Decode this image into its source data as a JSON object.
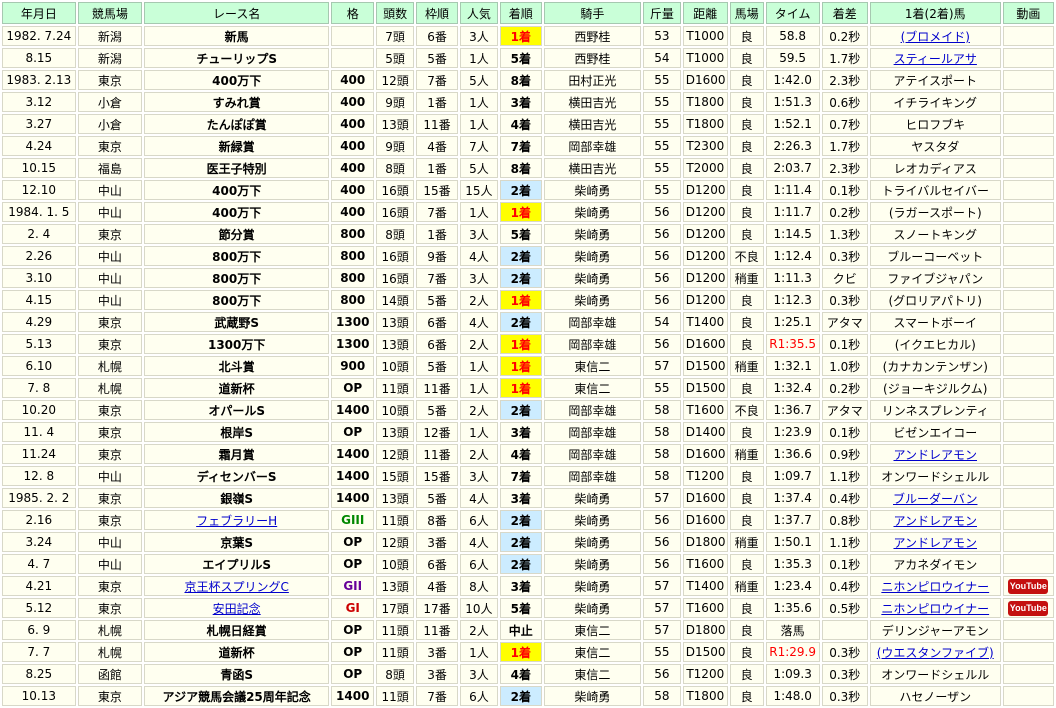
{
  "headers": [
    "年月日",
    "競馬場",
    "レース名",
    "格",
    "頭数",
    "枠順",
    "人気",
    "着順",
    "騎手",
    "斤量",
    "距離",
    "馬場",
    "タイム",
    "着差",
    "1着(2着)馬",
    "動画"
  ],
  "colors": {
    "header_bg": "#c9ffd8",
    "cell_bg": "#fffff0",
    "win_bg": "#ffff00",
    "win_text": "#ff0000",
    "second_bg": "#ccecff",
    "link": "#0000cc"
  },
  "rows": [
    {
      "date": "1982. 7.24",
      "course": "新潟",
      "race": "新馬",
      "race_link": false,
      "grade": "",
      "field": "7頭",
      "gate": "6番",
      "pop": "3人",
      "result": "1着",
      "jockey": "西野桂",
      "weight": "53",
      "distance": "T1000",
      "track": "良",
      "time": "58.8",
      "time_red": false,
      "margin": "0.2秒",
      "winner": "(ブロメイド)",
      "winner_link": true,
      "video": false
    },
    {
      "date": "8.15",
      "course": "新潟",
      "race": "チューリップS",
      "race_link": false,
      "grade": "",
      "field": "5頭",
      "gate": "5番",
      "pop": "1人",
      "result": "5着",
      "jockey": "西野桂",
      "weight": "54",
      "distance": "T1000",
      "track": "良",
      "time": "59.5",
      "time_red": false,
      "margin": "1.7秒",
      "winner": "スティールアサ",
      "winner_link": true,
      "video": false
    },
    {
      "date": "1983. 2.13",
      "course": "東京",
      "race": "400万下",
      "race_link": false,
      "grade": "400",
      "field": "12頭",
      "gate": "7番",
      "pop": "5人",
      "result": "8着",
      "jockey": "田村正光",
      "weight": "55",
      "distance": "D1600",
      "track": "良",
      "time": "1:42.0",
      "time_red": false,
      "margin": "2.3秒",
      "winner": "アテイスポート",
      "winner_link": false,
      "video": false
    },
    {
      "date": "3.12",
      "course": "小倉",
      "race": "すみれ賞",
      "race_link": false,
      "grade": "400",
      "field": "9頭",
      "gate": "1番",
      "pop": "1人",
      "result": "3着",
      "jockey": "横田吉光",
      "weight": "55",
      "distance": "T1800",
      "track": "良",
      "time": "1:51.3",
      "time_red": false,
      "margin": "0.6秒",
      "winner": "イチライキング",
      "winner_link": false,
      "video": false
    },
    {
      "date": "3.27",
      "course": "小倉",
      "race": "たんぽぽ賞",
      "race_link": false,
      "grade": "400",
      "field": "13頭",
      "gate": "11番",
      "pop": "1人",
      "result": "4着",
      "jockey": "横田吉光",
      "weight": "55",
      "distance": "T1800",
      "track": "良",
      "time": "1:52.1",
      "time_red": false,
      "margin": "0.7秒",
      "winner": "ヒロフブキ",
      "winner_link": false,
      "video": false
    },
    {
      "date": "4.24",
      "course": "東京",
      "race": "新緑賞",
      "race_link": false,
      "grade": "400",
      "field": "9頭",
      "gate": "4番",
      "pop": "7人",
      "result": "7着",
      "jockey": "岡部幸雄",
      "weight": "55",
      "distance": "T2300",
      "track": "良",
      "time": "2:26.3",
      "time_red": false,
      "margin": "1.7秒",
      "winner": "ヤスタダ",
      "winner_link": false,
      "video": false
    },
    {
      "date": "10.15",
      "course": "福島",
      "race": "医王子特別",
      "race_link": false,
      "grade": "400",
      "field": "8頭",
      "gate": "1番",
      "pop": "5人",
      "result": "8着",
      "jockey": "横田吉光",
      "weight": "55",
      "distance": "T2000",
      "track": "良",
      "time": "2:03.7",
      "time_red": false,
      "margin": "2.3秒",
      "winner": "レオカディアス",
      "winner_link": false,
      "video": false
    },
    {
      "date": "12.10",
      "course": "中山",
      "race": "400万下",
      "race_link": false,
      "grade": "400",
      "field": "16頭",
      "gate": "15番",
      "pop": "15人",
      "result": "2着",
      "jockey": "柴崎勇",
      "weight": "55",
      "distance": "D1200",
      "track": "良",
      "time": "1:11.4",
      "time_red": false,
      "margin": "0.1秒",
      "winner": "トライバルセイバー",
      "winner_link": false,
      "video": false
    },
    {
      "date": "1984. 1. 5",
      "course": "中山",
      "race": "400万下",
      "race_link": false,
      "grade": "400",
      "field": "16頭",
      "gate": "7番",
      "pop": "1人",
      "result": "1着",
      "jockey": "柴崎勇",
      "weight": "56",
      "distance": "D1200",
      "track": "良",
      "time": "1:11.7",
      "time_red": false,
      "margin": "0.2秒",
      "winner": "(ラガースポート)",
      "winner_link": false,
      "video": false
    },
    {
      "date": "2. 4",
      "course": "東京",
      "race": "節分賞",
      "race_link": false,
      "grade": "800",
      "field": "8頭",
      "gate": "1番",
      "pop": "3人",
      "result": "5着",
      "jockey": "柴崎勇",
      "weight": "56",
      "distance": "D1200",
      "track": "良",
      "time": "1:14.5",
      "time_red": false,
      "margin": "1.3秒",
      "winner": "スノートキング",
      "winner_link": false,
      "video": false
    },
    {
      "date": "2.26",
      "course": "中山",
      "race": "800万下",
      "race_link": false,
      "grade": "800",
      "field": "16頭",
      "gate": "9番",
      "pop": "4人",
      "result": "2着",
      "jockey": "柴崎勇",
      "weight": "56",
      "distance": "D1200",
      "track": "不良",
      "time": "1:12.4",
      "time_red": false,
      "margin": "0.3秒",
      "winner": "ブルーコーベット",
      "winner_link": false,
      "video": false
    },
    {
      "date": "3.10",
      "course": "中山",
      "race": "800万下",
      "race_link": false,
      "grade": "800",
      "field": "16頭",
      "gate": "7番",
      "pop": "3人",
      "result": "2着",
      "jockey": "柴崎勇",
      "weight": "56",
      "distance": "D1200",
      "track": "稍重",
      "time": "1:11.3",
      "time_red": false,
      "margin": "クビ",
      "winner": "ファイブジャパン",
      "winner_link": false,
      "video": false
    },
    {
      "date": "4.15",
      "course": "中山",
      "race": "800万下",
      "race_link": false,
      "grade": "800",
      "field": "14頭",
      "gate": "5番",
      "pop": "2人",
      "result": "1着",
      "jockey": "柴崎勇",
      "weight": "56",
      "distance": "D1200",
      "track": "良",
      "time": "1:12.3",
      "time_red": false,
      "margin": "0.3秒",
      "winner": "(グロリアパトリ)",
      "winner_link": false,
      "video": false
    },
    {
      "date": "4.29",
      "course": "東京",
      "race": "武蔵野S",
      "race_link": false,
      "grade": "1300",
      "field": "13頭",
      "gate": "6番",
      "pop": "4人",
      "result": "2着",
      "jockey": "岡部幸雄",
      "weight": "54",
      "distance": "T1400",
      "track": "良",
      "time": "1:25.1",
      "time_red": false,
      "margin": "アタマ",
      "winner": "スマートボーイ",
      "winner_link": false,
      "video": false
    },
    {
      "date": "5.13",
      "course": "東京",
      "race": "1300万下",
      "race_link": false,
      "grade": "1300",
      "field": "13頭",
      "gate": "6番",
      "pop": "2人",
      "result": "1着",
      "jockey": "岡部幸雄",
      "weight": "56",
      "distance": "D1600",
      "track": "良",
      "time": "R1:35.5",
      "time_red": true,
      "margin": "0.1秒",
      "winner": "(イクエヒカル)",
      "winner_link": false,
      "video": false
    },
    {
      "date": "6.10",
      "course": "札幌",
      "race": "北斗賞",
      "race_link": false,
      "grade": "900",
      "field": "10頭",
      "gate": "5番",
      "pop": "1人",
      "result": "1着",
      "jockey": "東信二",
      "weight": "57",
      "distance": "D1500",
      "track": "稍重",
      "time": "1:32.1",
      "time_red": false,
      "margin": "1.0秒",
      "winner": "(カナカンテンザン)",
      "winner_link": false,
      "video": false
    },
    {
      "date": "7. 8",
      "course": "札幌",
      "race": "道新杯",
      "race_link": false,
      "grade": "OP",
      "field": "11頭",
      "gate": "11番",
      "pop": "1人",
      "result": "1着",
      "jockey": "東信二",
      "weight": "55",
      "distance": "D1500",
      "track": "良",
      "time": "1:32.4",
      "time_red": false,
      "margin": "0.2秒",
      "winner": "(ジョーキジルクム)",
      "winner_link": false,
      "video": false
    },
    {
      "date": "10.20",
      "course": "東京",
      "race": "オパールS",
      "race_link": false,
      "grade": "1400",
      "field": "10頭",
      "gate": "5番",
      "pop": "2人",
      "result": "2着",
      "jockey": "岡部幸雄",
      "weight": "58",
      "distance": "T1600",
      "track": "不良",
      "time": "1:36.7",
      "time_red": false,
      "margin": "アタマ",
      "winner": "リンネスプレンティ",
      "winner_link": false,
      "video": false
    },
    {
      "date": "11. 4",
      "course": "東京",
      "race": "根岸S",
      "race_link": false,
      "grade": "OP",
      "field": "13頭",
      "gate": "12番",
      "pop": "1人",
      "result": "3着",
      "jockey": "岡部幸雄",
      "weight": "58",
      "distance": "D1400",
      "track": "良",
      "time": "1:23.9",
      "time_red": false,
      "margin": "0.1秒",
      "winner": "ビゼンエイコー",
      "winner_link": false,
      "video": false
    },
    {
      "date": "11.24",
      "course": "東京",
      "race": "霜月賞",
      "race_link": false,
      "grade": "1400",
      "field": "12頭",
      "gate": "11番",
      "pop": "2人",
      "result": "4着",
      "jockey": "岡部幸雄",
      "weight": "58",
      "distance": "D1600",
      "track": "稍重",
      "time": "1:36.6",
      "time_red": false,
      "margin": "0.9秒",
      "winner": "アンドレアモン",
      "winner_link": true,
      "video": false
    },
    {
      "date": "12. 8",
      "course": "中山",
      "race": "ディセンバーS",
      "race_link": false,
      "grade": "1400",
      "field": "15頭",
      "gate": "15番",
      "pop": "3人",
      "result": "7着",
      "jockey": "岡部幸雄",
      "weight": "58",
      "distance": "T1200",
      "track": "良",
      "time": "1:09.7",
      "time_red": false,
      "margin": "1.1秒",
      "winner": "オンワードシェルル",
      "winner_link": false,
      "video": false
    },
    {
      "date": "1985. 2. 2",
      "course": "東京",
      "race": "銀嶺S",
      "race_link": false,
      "grade": "1400",
      "field": "13頭",
      "gate": "5番",
      "pop": "4人",
      "result": "3着",
      "jockey": "柴崎勇",
      "weight": "57",
      "distance": "D1600",
      "track": "良",
      "time": "1:37.4",
      "time_red": false,
      "margin": "0.4秒",
      "winner": "ブルーダーバン",
      "winner_link": true,
      "video": false
    },
    {
      "date": "2.16",
      "course": "東京",
      "race": "フェブラリーH",
      "race_link": true,
      "grade": "GIII",
      "field": "11頭",
      "gate": "8番",
      "pop": "6人",
      "result": "2着",
      "jockey": "柴崎勇",
      "weight": "56",
      "distance": "D1600",
      "track": "良",
      "time": "1:37.7",
      "time_red": false,
      "margin": "0.8秒",
      "winner": "アンドレアモン",
      "winner_link": true,
      "video": false
    },
    {
      "date": "3.24",
      "course": "中山",
      "race": "京葉S",
      "race_link": false,
      "grade": "OP",
      "field": "12頭",
      "gate": "3番",
      "pop": "4人",
      "result": "2着",
      "jockey": "柴崎勇",
      "weight": "56",
      "distance": "D1800",
      "track": "稍重",
      "time": "1:50.1",
      "time_red": false,
      "margin": "1.1秒",
      "winner": "アンドレアモン",
      "winner_link": true,
      "video": false
    },
    {
      "date": "4. 7",
      "course": "中山",
      "race": "エイプリルS",
      "race_link": false,
      "grade": "OP",
      "field": "10頭",
      "gate": "6番",
      "pop": "6人",
      "result": "2着",
      "jockey": "柴崎勇",
      "weight": "56",
      "distance": "T1600",
      "track": "良",
      "time": "1:35.3",
      "time_red": false,
      "margin": "0.1秒",
      "winner": "アカネダイモン",
      "winner_link": false,
      "video": false
    },
    {
      "date": "4.21",
      "course": "東京",
      "race": "京王杯スプリングC",
      "race_link": true,
      "grade": "GII",
      "field": "13頭",
      "gate": "4番",
      "pop": "8人",
      "result": "3着",
      "jockey": "柴崎勇",
      "weight": "57",
      "distance": "T1400",
      "track": "稍重",
      "time": "1:23.4",
      "time_red": false,
      "margin": "0.4秒",
      "winner": "ニホンピロウイナー",
      "winner_link": true,
      "video": true
    },
    {
      "date": "5.12",
      "course": "東京",
      "race": "安田記念",
      "race_link": true,
      "grade": "GI",
      "field": "17頭",
      "gate": "17番",
      "pop": "10人",
      "result": "5着",
      "jockey": "柴崎勇",
      "weight": "57",
      "distance": "T1600",
      "track": "良",
      "time": "1:35.6",
      "time_red": false,
      "margin": "0.5秒",
      "winner": "ニホンピロウイナー",
      "winner_link": true,
      "video": true
    },
    {
      "date": "6. 9",
      "course": "札幌",
      "race": "札幌日経賞",
      "race_link": false,
      "grade": "OP",
      "field": "11頭",
      "gate": "11番",
      "pop": "2人",
      "result": "中止",
      "jockey": "東信二",
      "weight": "57",
      "distance": "D1800",
      "track": "良",
      "time": "落馬",
      "time_red": false,
      "margin": "",
      "winner": "デリンジャーアモン",
      "winner_link": false,
      "video": false
    },
    {
      "date": "7. 7",
      "course": "札幌",
      "race": "道新杯",
      "race_link": false,
      "grade": "OP",
      "field": "11頭",
      "gate": "3番",
      "pop": "1人",
      "result": "1着",
      "jockey": "東信二",
      "weight": "55",
      "distance": "D1500",
      "track": "良",
      "time": "R1:29.9",
      "time_red": true,
      "margin": "0.3秒",
      "winner": "(ウエスタンファイブ)",
      "winner_link": true,
      "video": false
    },
    {
      "date": "8.25",
      "course": "函館",
      "race": "青函S",
      "race_link": false,
      "grade": "OP",
      "field": "8頭",
      "gate": "3番",
      "pop": "3人",
      "result": "4着",
      "jockey": "東信二",
      "weight": "56",
      "distance": "T1200",
      "track": "良",
      "time": "1:09.3",
      "time_red": false,
      "margin": "0.3秒",
      "winner": "オンワードシェルル",
      "winner_link": false,
      "video": false
    },
    {
      "date": "10.13",
      "course": "東京",
      "race": "アジア競馬会議25周年記念",
      "race_link": false,
      "grade": "1400",
      "field": "11頭",
      "gate": "7番",
      "pop": "6人",
      "result": "2着",
      "jockey": "柴崎勇",
      "weight": "58",
      "distance": "T1800",
      "track": "良",
      "time": "1:48.0",
      "time_red": false,
      "margin": "0.3秒",
      "winner": "ハセノーザン",
      "winner_link": false,
      "video": false
    }
  ],
  "video_badge": "YouTube",
  "icons": {
    "video": "youtube-icon"
  }
}
